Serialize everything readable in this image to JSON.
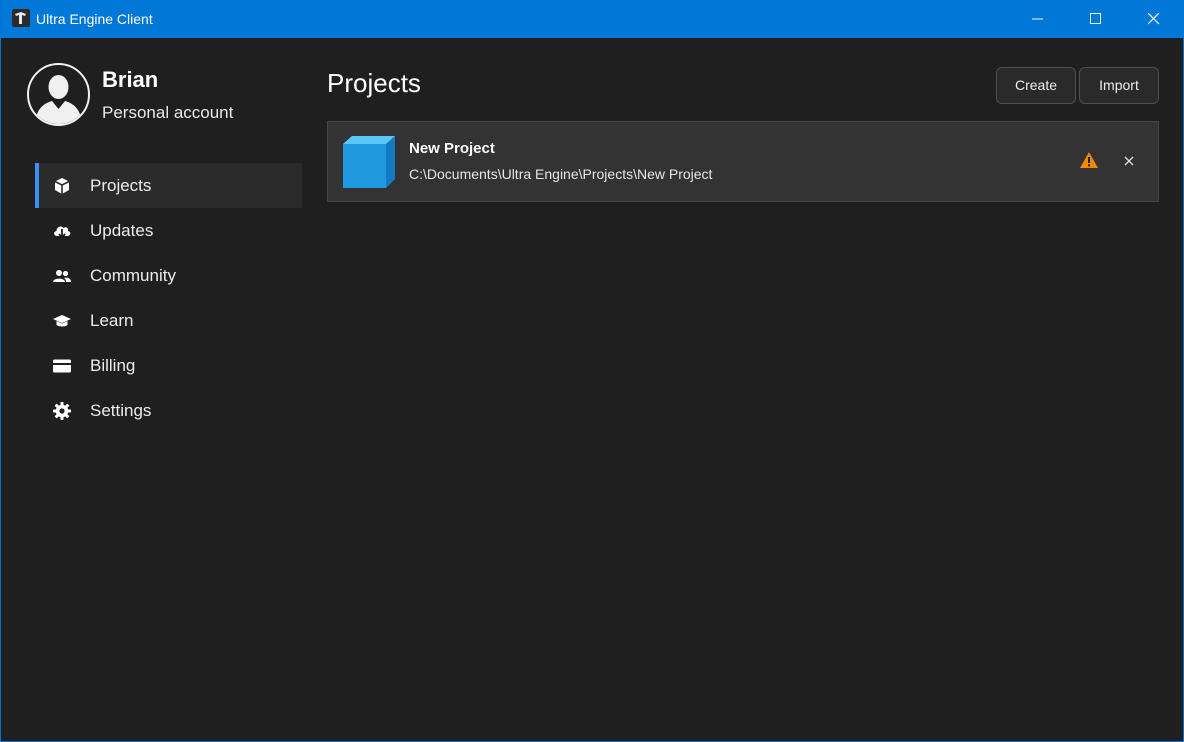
{
  "window": {
    "title": "Ultra Engine Client",
    "accent_color": "#0078d7"
  },
  "profile": {
    "name": "Brian",
    "account_type": "Personal account",
    "avatar_icon": "user-silhouette-icon"
  },
  "sidebar": {
    "items": [
      {
        "label": "Projects",
        "icon": "cube-icon",
        "active": true
      },
      {
        "label": "Updates",
        "icon": "cloud-download-icon",
        "active": false
      },
      {
        "label": "Community",
        "icon": "people-icon",
        "active": false
      },
      {
        "label": "Learn",
        "icon": "graduation-cap-icon",
        "active": false
      },
      {
        "label": "Billing",
        "icon": "credit-card-icon",
        "active": false
      },
      {
        "label": "Settings",
        "icon": "gear-icon",
        "active": false
      }
    ],
    "active_indicator_color": "#3b8ef5"
  },
  "main": {
    "title": "Projects",
    "create_label": "Create",
    "import_label": "Import",
    "projects": [
      {
        "name": "New Project",
        "path": "C:\\Documents\\Ultra Engine\\Projects\\New Project",
        "icon": "blue-cube-icon",
        "status_icon": "warning-icon",
        "status_color": "#f08a00"
      }
    ]
  }
}
